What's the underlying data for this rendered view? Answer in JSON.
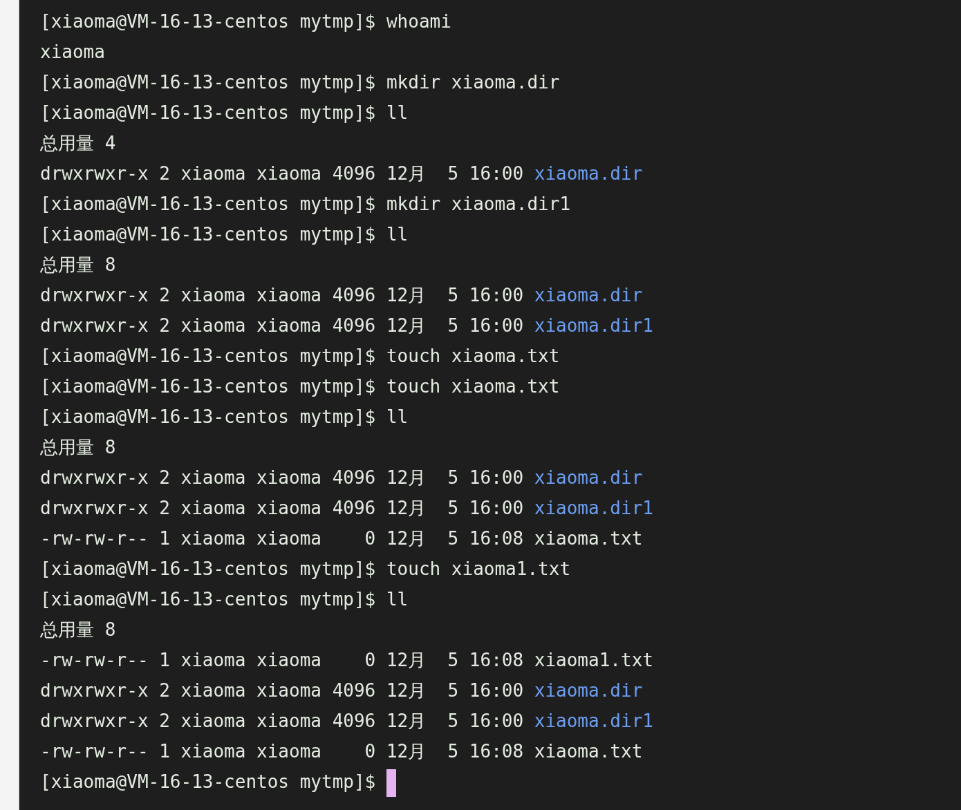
{
  "terminal": {
    "lines": [
      {
        "kind": "prompt",
        "prompt": "[xiaoma@VM-16-13-centos mytmp]$",
        "command": "whoami"
      },
      {
        "kind": "output",
        "text": "xiaoma"
      },
      {
        "kind": "prompt",
        "prompt": "[xiaoma@VM-16-13-centos mytmp]$",
        "command": "mkdir xiaoma.dir"
      },
      {
        "kind": "prompt",
        "prompt": "[xiaoma@VM-16-13-centos mytmp]$",
        "command": "ll"
      },
      {
        "kind": "output",
        "text": "总用量 4"
      },
      {
        "kind": "entry",
        "info": "drwxrwxr-x 2 xiaoma xiaoma 4096 12月  5 16:00",
        "name": "xiaoma.dir",
        "directory": true
      },
      {
        "kind": "prompt",
        "prompt": "[xiaoma@VM-16-13-centos mytmp]$",
        "command": "mkdir xiaoma.dir1"
      },
      {
        "kind": "prompt",
        "prompt": "[xiaoma@VM-16-13-centos mytmp]$",
        "command": "ll"
      },
      {
        "kind": "output",
        "text": "总用量 8"
      },
      {
        "kind": "entry",
        "info": "drwxrwxr-x 2 xiaoma xiaoma 4096 12月  5 16:00",
        "name": "xiaoma.dir",
        "directory": true
      },
      {
        "kind": "entry",
        "info": "drwxrwxr-x 2 xiaoma xiaoma 4096 12月  5 16:00",
        "name": "xiaoma.dir1",
        "directory": true
      },
      {
        "kind": "prompt",
        "prompt": "[xiaoma@VM-16-13-centos mytmp]$",
        "command": "touch xiaoma.txt"
      },
      {
        "kind": "prompt",
        "prompt": "[xiaoma@VM-16-13-centos mytmp]$",
        "command": "touch xiaoma.txt"
      },
      {
        "kind": "prompt",
        "prompt": "[xiaoma@VM-16-13-centos mytmp]$",
        "command": "ll"
      },
      {
        "kind": "output",
        "text": "总用量 8"
      },
      {
        "kind": "entry",
        "info": "drwxrwxr-x 2 xiaoma xiaoma 4096 12月  5 16:00",
        "name": "xiaoma.dir",
        "directory": true
      },
      {
        "kind": "entry",
        "info": "drwxrwxr-x 2 xiaoma xiaoma 4096 12月  5 16:00",
        "name": "xiaoma.dir1",
        "directory": true
      },
      {
        "kind": "entry",
        "info": "-rw-rw-r-- 1 xiaoma xiaoma    0 12月  5 16:08",
        "name": "xiaoma.txt",
        "directory": false
      },
      {
        "kind": "prompt",
        "prompt": "[xiaoma@VM-16-13-centos mytmp]$",
        "command": "touch xiaoma1.txt"
      },
      {
        "kind": "prompt",
        "prompt": "[xiaoma@VM-16-13-centos mytmp]$",
        "command": "ll"
      },
      {
        "kind": "output",
        "text": "总用量 8"
      },
      {
        "kind": "entry",
        "info": "-rw-rw-r-- 1 xiaoma xiaoma    0 12月  5 16:08",
        "name": "xiaoma1.txt",
        "directory": false
      },
      {
        "kind": "entry",
        "info": "drwxrwxr-x 2 xiaoma xiaoma 4096 12月  5 16:00",
        "name": "xiaoma.dir",
        "directory": true
      },
      {
        "kind": "entry",
        "info": "drwxrwxr-x 2 xiaoma xiaoma 4096 12月  5 16:00",
        "name": "xiaoma.dir1",
        "directory": true
      },
      {
        "kind": "entry",
        "info": "-rw-rw-r-- 1 xiaoma xiaoma    0 12月  5 16:08",
        "name": "xiaoma.txt",
        "directory": false
      },
      {
        "kind": "prompt",
        "prompt": "[xiaoma@VM-16-13-centos mytmp]$",
        "cursor": true
      }
    ]
  }
}
